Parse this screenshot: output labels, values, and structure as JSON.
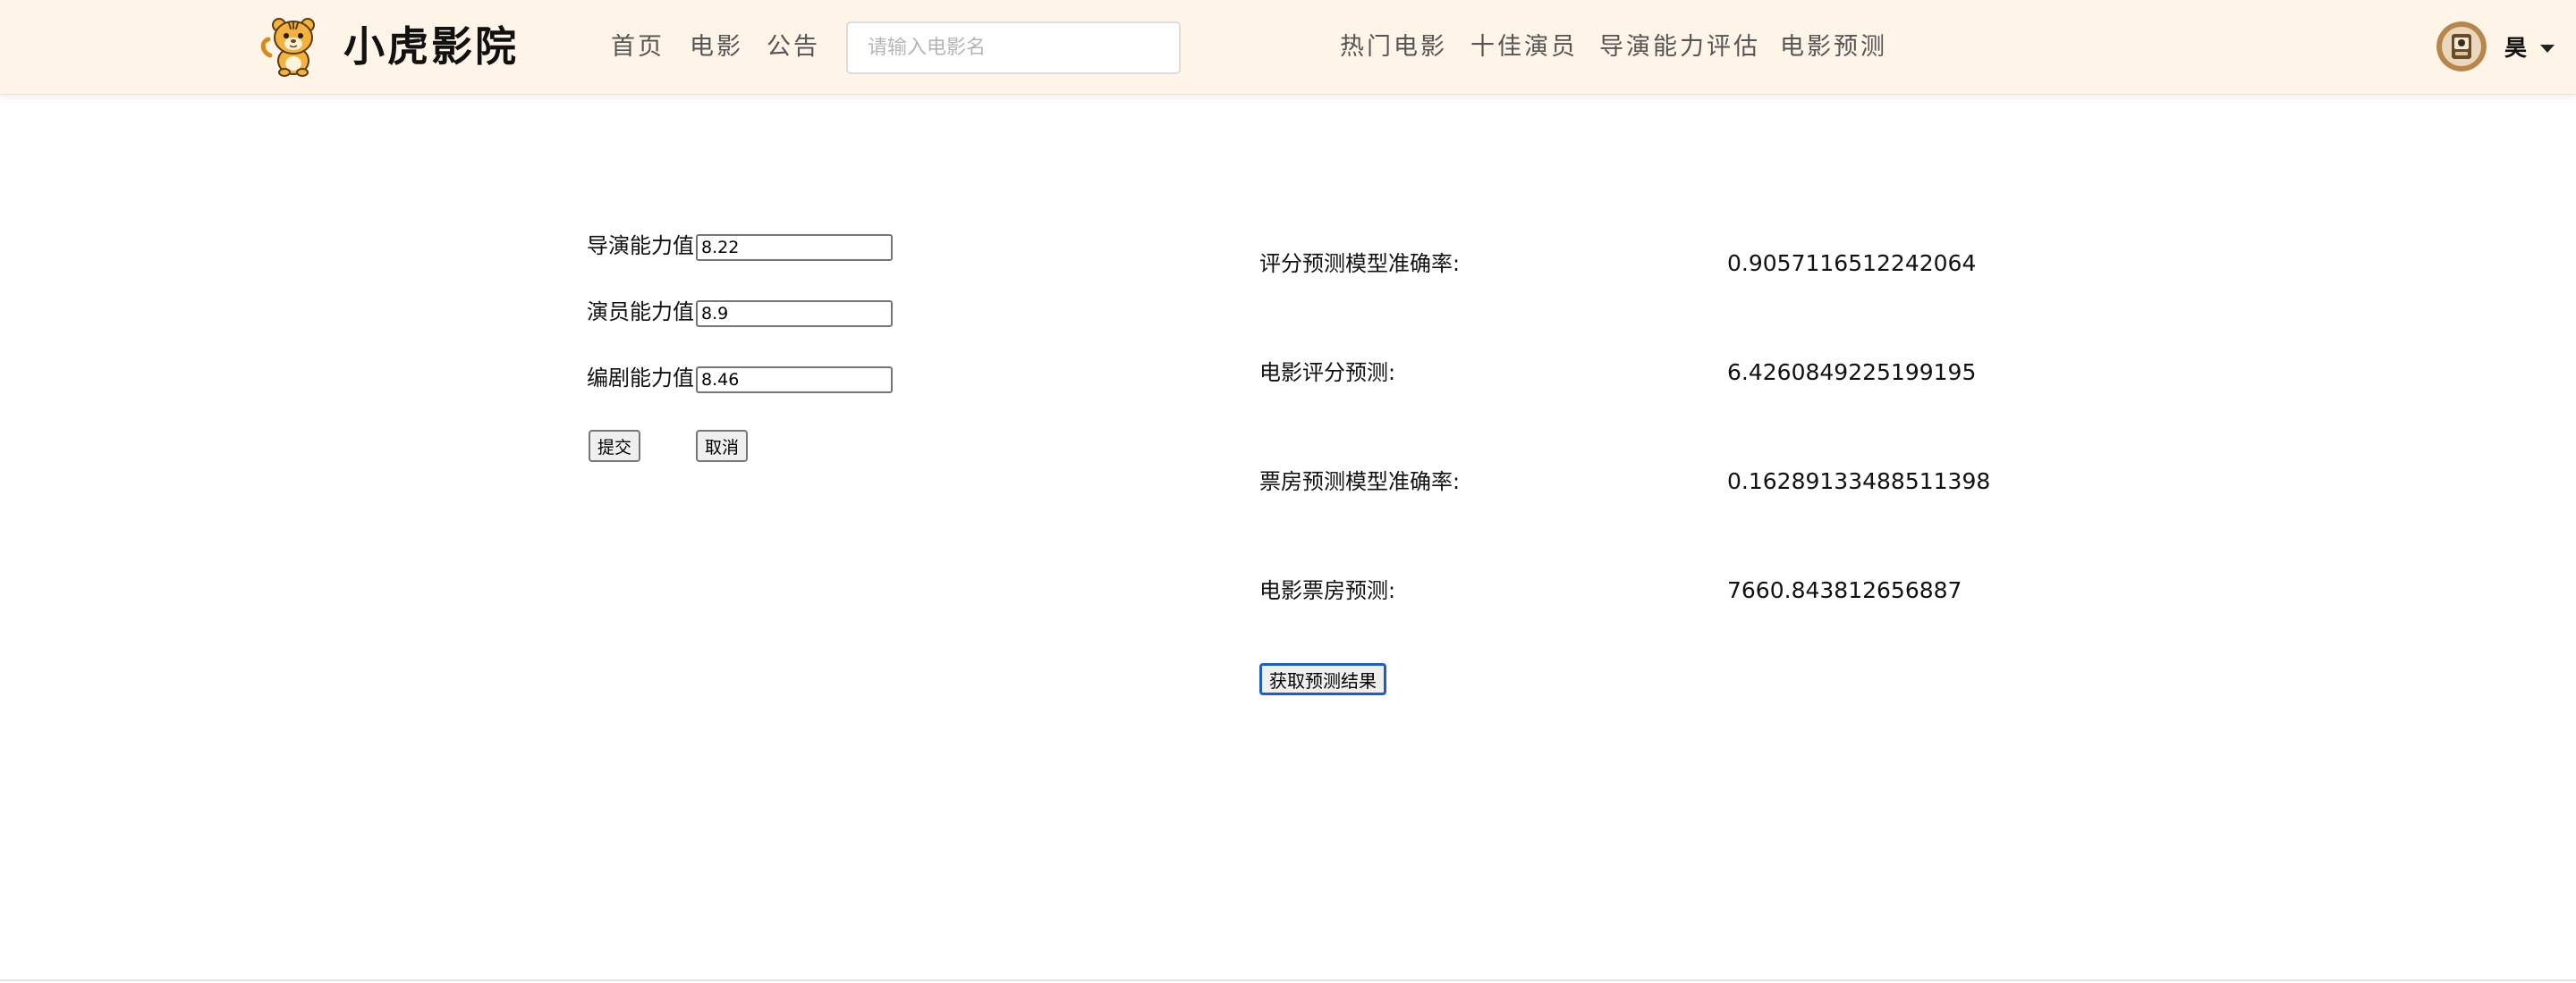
{
  "navbar": {
    "brand": "小虎影院",
    "left_links": [
      {
        "label": "首页"
      },
      {
        "label": "电影"
      },
      {
        "label": "公告"
      }
    ],
    "search_placeholder": "请输入电影名",
    "right_links": [
      {
        "label": "热门电影"
      },
      {
        "label": "十佳演员"
      },
      {
        "label": "导演能力评估"
      },
      {
        "label": "电影预测"
      }
    ],
    "user_name": "昊",
    "icons": {
      "logo": "tiger-logo-icon",
      "avatar": "user-avatar",
      "caret": "caret-down-icon"
    }
  },
  "form": {
    "fields": [
      {
        "label": "导演能力值",
        "value": "8.22"
      },
      {
        "label": "演员能力值",
        "value": "8.9"
      },
      {
        "label": "编剧能力值",
        "value": "8.46"
      }
    ],
    "submit_label": "提交",
    "cancel_label": "取消"
  },
  "results": {
    "rows": [
      {
        "label": "评分预测模型准确率:",
        "value": "0.9057116512242064"
      },
      {
        "label": "电影评分预测:",
        "value": "6.4260849225199195"
      },
      {
        "label": "票房预测模型准确率:",
        "value": "0.16289133488511398"
      },
      {
        "label": "电影票房预测:",
        "value": "7660.843812656887"
      }
    ],
    "button_label": "获取预测结果"
  },
  "colors": {
    "navbar_bg": "#fff4e8",
    "nav_text": "#555555",
    "focus_accent": "#1d5fc7",
    "logo_orange": "#e8a22b"
  }
}
